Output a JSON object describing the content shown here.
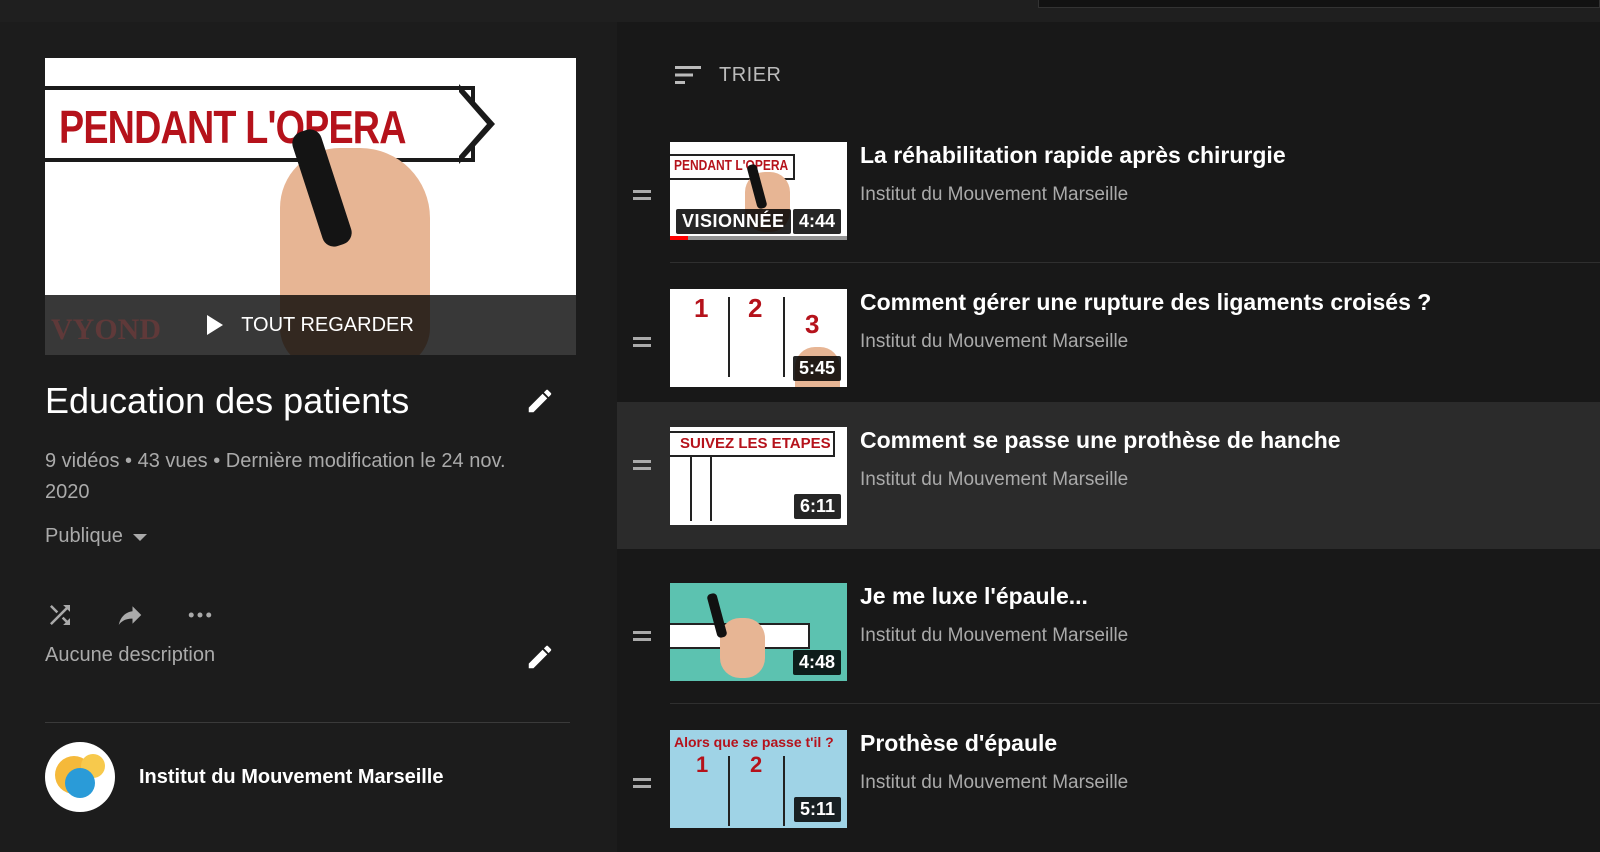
{
  "playlist": {
    "hero_text": "PENDANT L'OPERA",
    "hero_watermark": "VYOND",
    "play_all_label": "TOUT REGARDER",
    "title": "Education des patients",
    "stats": "9 vidéos • 43 vues • Dernière modification le 24 nov. 2020",
    "privacy": "Publique",
    "description": "Aucune description",
    "owner": "Institut du Mouvement Marseille",
    "icons": [
      "edit-icon",
      "shuffle-icon",
      "share-icon",
      "more-icon",
      "caret-down-icon",
      "play-icon"
    ]
  },
  "list": {
    "sort_label": "TRIER",
    "items": [
      {
        "title": "La réhabilitation rapide après chirurgie",
        "channel": "Institut du Mouvement Marseille",
        "duration": "4:44",
        "watched_label": "VISIONNÉE",
        "progress_fraction": 0.1,
        "thumb_text": "PENDANT L'OPERA",
        "active": false
      },
      {
        "title": "Comment gérer une rupture des ligaments croisés ?",
        "channel": "Institut du Mouvement Marseille",
        "duration": "5:45",
        "thumb_text": [
          "1",
          "2",
          "3"
        ],
        "active": false
      },
      {
        "title": "Comment se passe une prothèse de hanche",
        "channel": "Institut du Mouvement Marseille",
        "duration": "6:11",
        "thumb_text": "SUIVEZ LES ETAPES",
        "active": true
      },
      {
        "title": "Je me luxe l'épaule...",
        "channel": "Institut du Mouvement Marseille",
        "duration": "4:48",
        "active": false
      },
      {
        "title": "Prothèse d'épaule",
        "channel": "Institut du Mouvement Marseille",
        "duration": "5:11",
        "thumb_text": "Alors que se passe t'il ?",
        "active": false
      }
    ]
  },
  "colors": {
    "background": "#181818",
    "panel": "#1c1c1c",
    "active_row": "#2b2b2b",
    "progress": "#ff0000",
    "accent_red": "#b5121b"
  }
}
